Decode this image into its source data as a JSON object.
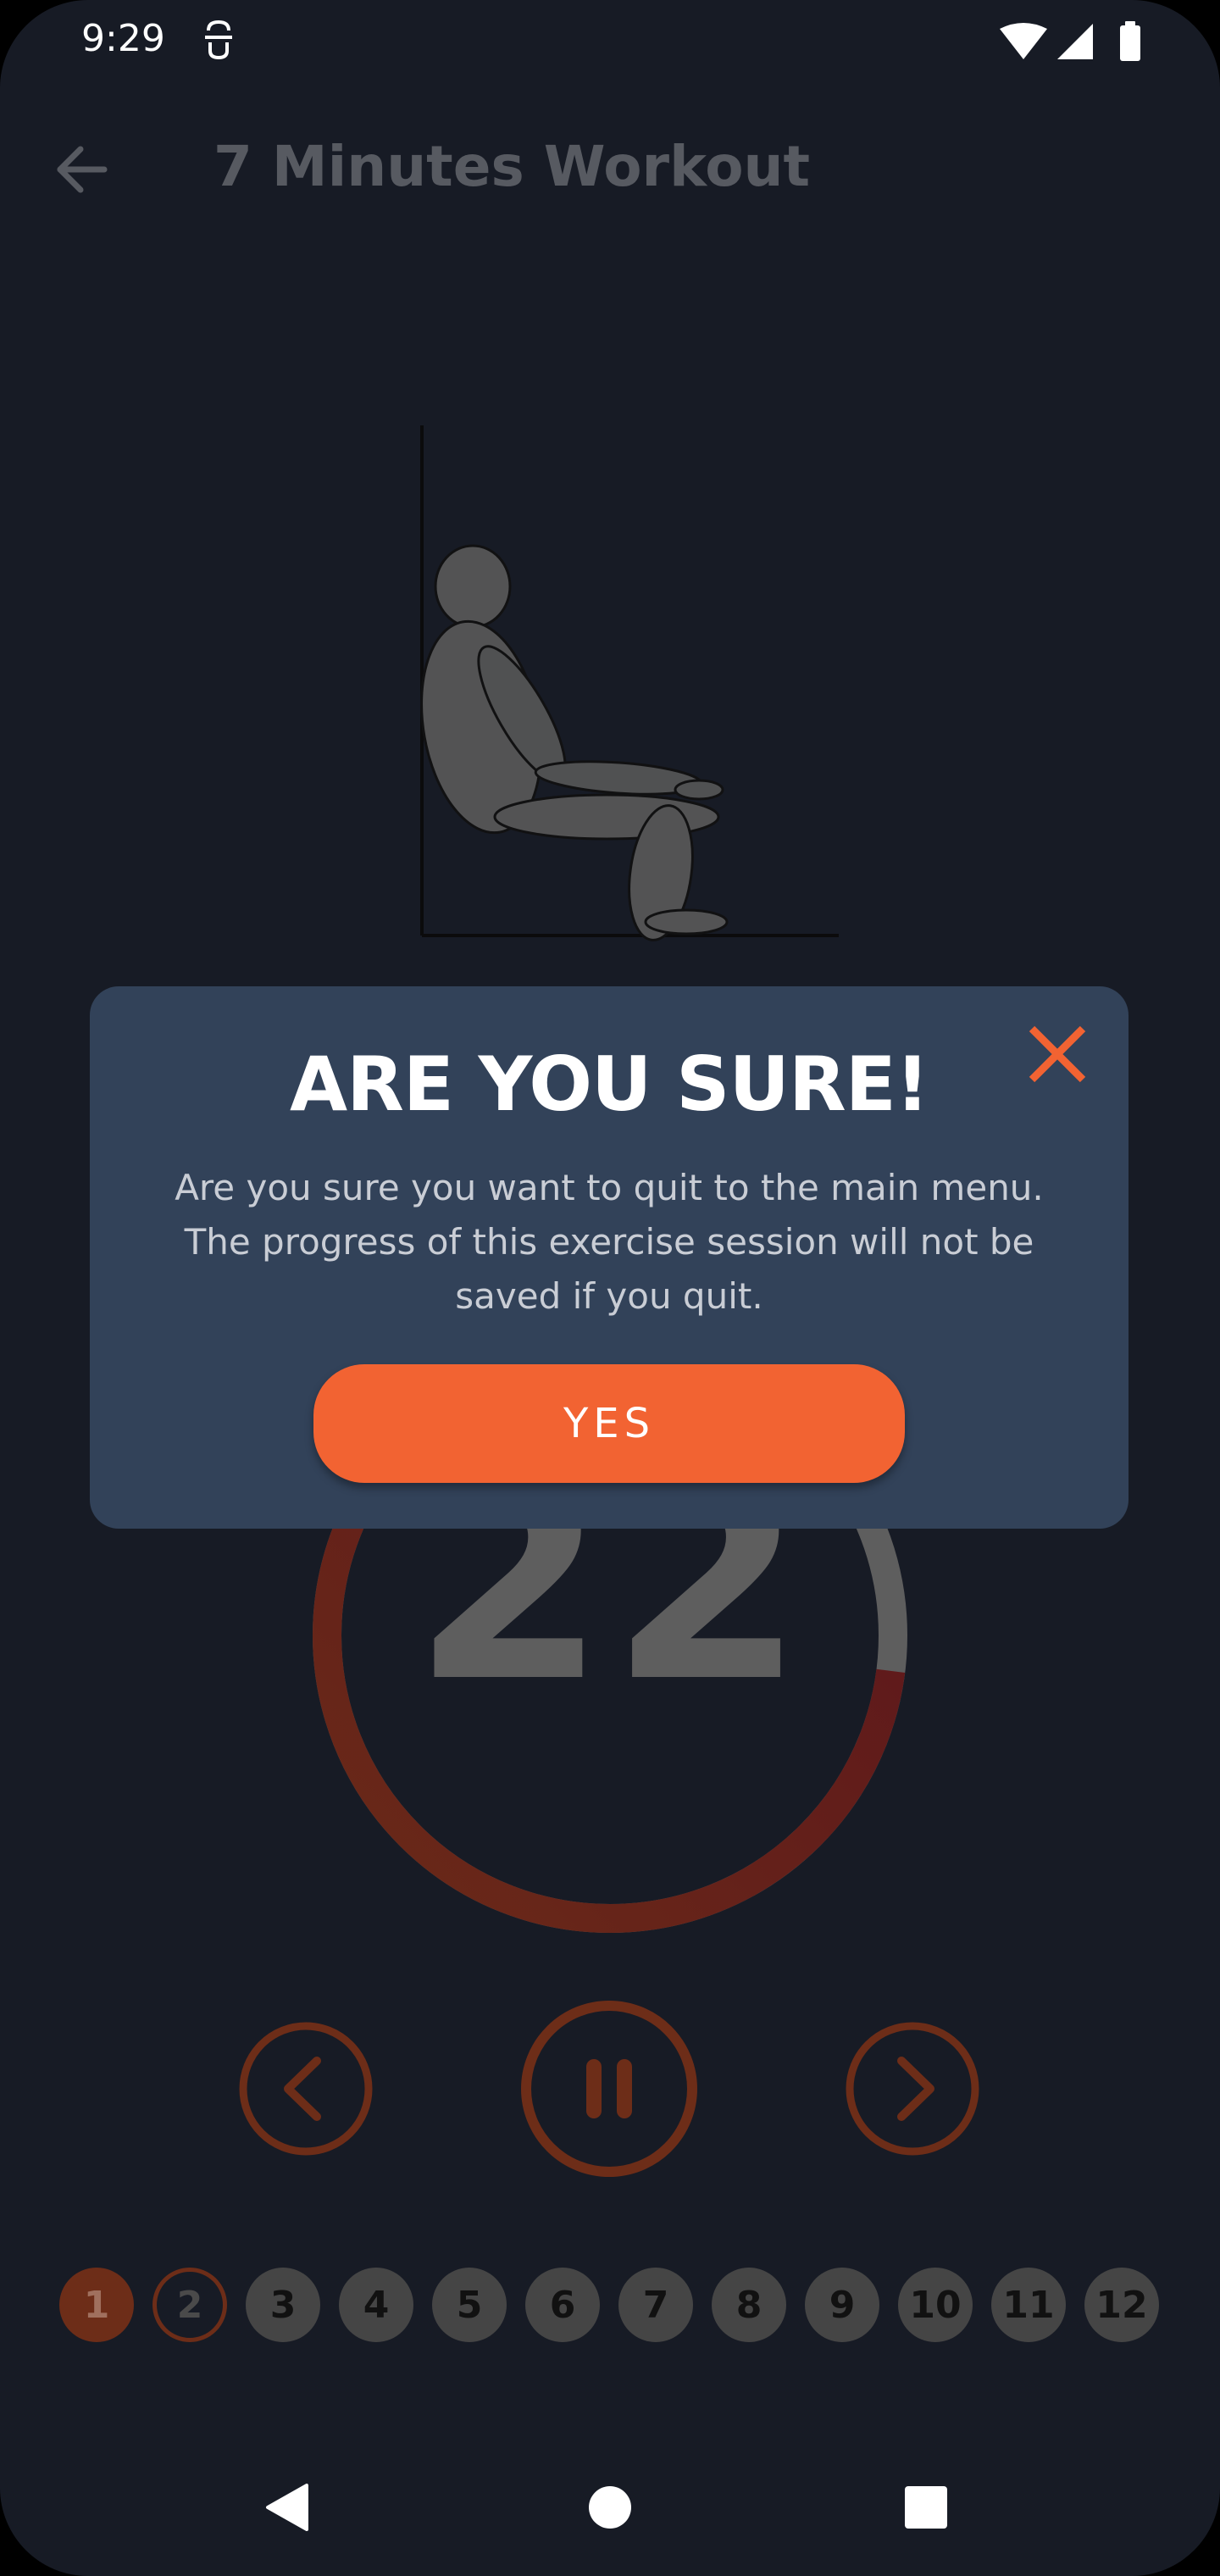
{
  "status_bar": {
    "time": "9:29",
    "icons": [
      "app-notification-icon",
      "wifi-icon",
      "signal-icon",
      "battery-icon"
    ]
  },
  "app_bar": {
    "title": "7 Minutes Workout",
    "back_icon": "arrow-left-icon"
  },
  "exercise": {
    "illustration": "wall-sit-figure"
  },
  "timer": {
    "value": "22",
    "progress_fraction": 0.73,
    "ring_colors": {
      "track": "#5e5e5e",
      "progress_start": "#6a2a18",
      "progress_end": "#5c141c"
    }
  },
  "controls": {
    "previous_icon": "chevron-left-circle-icon",
    "pause_icon": "pause-circle-icon",
    "next_icon": "chevron-right-circle-icon"
  },
  "steps": {
    "items": [
      "1",
      "2",
      "3",
      "4",
      "5",
      "6",
      "7",
      "8",
      "9",
      "10",
      "11",
      "12"
    ],
    "completed": 1,
    "current": 2
  },
  "dialog": {
    "title": "ARE YOU SURE!",
    "message": "Are you sure you want to quit to the main menu. The progress of this exercise session will not be saved if you quit.",
    "confirm_label": "YES",
    "close_icon": "close-icon"
  },
  "nav_bar": {
    "icons": [
      "nav-back-icon",
      "nav-home-icon",
      "nav-recents-icon"
    ]
  },
  "colors": {
    "background": "#171b25",
    "dialog_background": "#324259",
    "accent": "#f26332",
    "dimmed_text": "#575a61"
  }
}
